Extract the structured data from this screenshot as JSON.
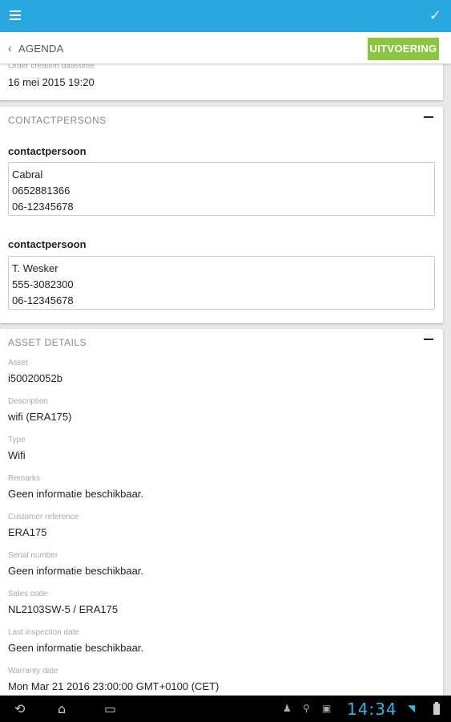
{
  "header": {
    "back_label": "AGENDA",
    "action_label": "UITVOERING"
  },
  "order": {
    "label": "Order creation date/time",
    "value": "16 mei 2015 19:20"
  },
  "contacts": {
    "title": "CONTACTPERSONS",
    "items": [
      {
        "label": "contactpersoon",
        "lines": [
          "Cabral",
          "0652881366",
          "06-12345678"
        ]
      },
      {
        "label": "contactpersoon",
        "lines": [
          "T. Wesker",
          "555-3082300",
          "06-12345678"
        ]
      }
    ]
  },
  "asset": {
    "title": "ASSET DETAILS",
    "fields": [
      {
        "label": "Asset",
        "value": "i50020052b"
      },
      {
        "label": "Description",
        "value": "wifi (ERA175)"
      },
      {
        "label": "Type",
        "value": "Wifi"
      },
      {
        "label": "Remarks",
        "value": "Geen informatie beschikbaar."
      },
      {
        "label": "Customer reference",
        "value": "ERA175"
      },
      {
        "label": "Serial number",
        "value": "Geen informatie beschikbaar."
      },
      {
        "label": "Sales code",
        "value": "NL2103SW-5 / ERA175"
      },
      {
        "label": "Last inspection date",
        "value": "Geen informatie beschikbaar."
      },
      {
        "label": "Warranty date",
        "value": "Mon Mar 21 2016 23:00:00 GMT+0100 (CET)"
      }
    ]
  },
  "statusbar": {
    "time": "14:34"
  },
  "colors": {
    "topbar": "#29a8e0",
    "action": "#8cc540",
    "clock": "#33b5e5"
  },
  "icons": [
    "menu-icon",
    "check-icon",
    "chevron-left-icon",
    "collapse-icon",
    "back-nav-icon",
    "home-nav-icon",
    "recents-nav-icon",
    "android-icon",
    "usb-icon",
    "image-icon",
    "wifi-icon",
    "battery-icon"
  ]
}
